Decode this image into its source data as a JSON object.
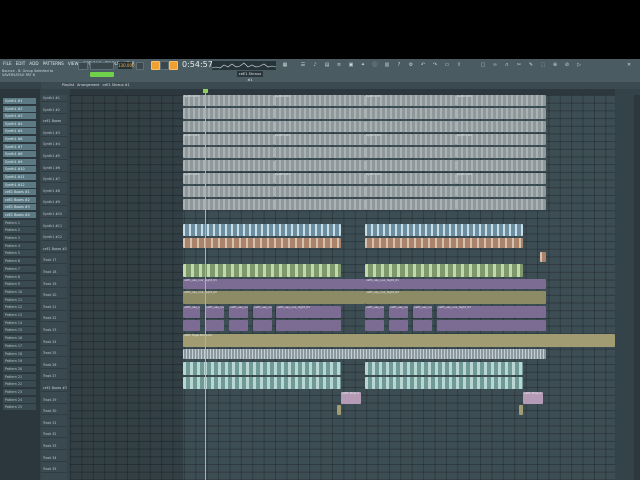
{
  "menu": [
    "FILE",
    "EDIT",
    "ADD",
    "PATTERNS",
    "VIEW",
    "OPTIONS",
    "TOOLS",
    "HELP"
  ],
  "hint": {
    "line1": "Bounce - B: Group Selected to",
    "line2": "SAVERSATILE PAT B"
  },
  "toolbar": {
    "pattern_label": "PAT",
    "song_label": "SONG",
    "tempo": "130.000",
    "time": "0:54:57",
    "pattern_selector": "ceE1 Shraux #1"
  },
  "playlist": {
    "tabs": [
      "Playlist",
      "Arrangement",
      "ceE1 Shraux #1"
    ]
  },
  "picker": {
    "patterns": [
      "Synth1 #1",
      "Synth1 #2",
      "Synth1 #3",
      "Synth1 #4",
      "Synth1 #5",
      "Synth1 #6",
      "Synth1 #7",
      "Synth1 #8",
      "Synth1 #9",
      "Synth1 #10",
      "Synth1 #11",
      "Synth1 #12",
      "ceE1 Boxes #1",
      "ceE1 Boxes #2",
      "ceE1 Boxes #3",
      "ceE1 Boxes #4"
    ],
    "audio": [
      "Pattern 1",
      "Pattern 2",
      "Pattern 3",
      "Pattern 4",
      "Pattern 5",
      "Pattern 6",
      "Pattern 7",
      "Pattern 8",
      "Pattern 9",
      "Pattern 10",
      "Pattern 11",
      "Pattern 12",
      "Pattern 13",
      "Pattern 14",
      "Pattern 15",
      "Pattern 16",
      "Pattern 17",
      "Pattern 18",
      "Pattern 19",
      "Pattern 20",
      "Pattern 21",
      "Pattern 22",
      "Pattern 23",
      "Pattern 24",
      "Pattern 25"
    ]
  },
  "tracks": [
    "Synth1 #1",
    "Synth1 #2",
    "ceE1 Boxes",
    "Synth1 #3",
    "Synth1 #4",
    "Synth1 #5",
    "Synth1 #6",
    "Synth1 #7",
    "Synth1 #8",
    "Synth1 #9",
    "Synth1 #10",
    "Synth1 #11",
    "Synth1 #12",
    "ceE1 Boxes #2",
    "Track 17",
    "Track 18",
    "Track 19",
    "Track 20",
    "Track 21",
    "Track 22",
    "Track 23",
    "Track 24",
    "Track 25",
    "Track 26",
    "Track 27",
    "ceE1 Boxes #3",
    "Track 29",
    "Track 30",
    "Track 31",
    "Track 32",
    "Track 33",
    "Track 34",
    "Track 35"
  ],
  "clips": {
    "synth": "Synth1 #1",
    "aud1": "ceE1_say_vox_hight_01",
    "aud2": "ceE1_say_vox_hight_02",
    "aud3": "ceE1_say_vox_hight_03",
    "aud4": "ceE1 Huge Drive 01",
    "aud5": "ceE1 Drop 1"
  }
}
